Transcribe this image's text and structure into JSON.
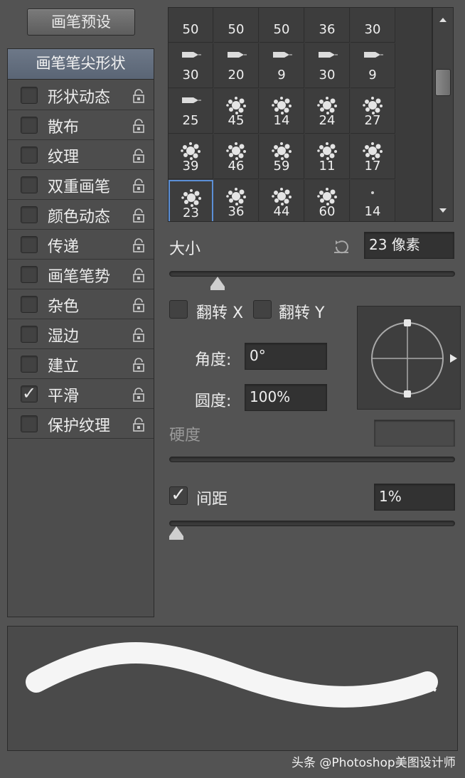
{
  "preset_button": "画笔预设",
  "left_panel": {
    "header": "画笔笔尖形状",
    "options": [
      {
        "label": "形状动态",
        "checked": false
      },
      {
        "label": "散布",
        "checked": false
      },
      {
        "label": "纹理",
        "checked": false
      },
      {
        "label": "双重画笔",
        "checked": false
      },
      {
        "label": "颜色动态",
        "checked": false
      },
      {
        "label": "传递",
        "checked": false
      },
      {
        "label": "画笔笔势",
        "checked": false
      },
      {
        "label": "杂色",
        "checked": false
      },
      {
        "label": "湿边",
        "checked": false
      },
      {
        "label": "建立",
        "checked": false
      },
      {
        "label": "平滑",
        "checked": true
      },
      {
        "label": "保护纹理",
        "checked": false
      }
    ]
  },
  "brush_grid": {
    "rows": [
      [
        {
          "size": "50",
          "kind": "round"
        },
        {
          "size": "50",
          "kind": "round"
        },
        {
          "size": "50",
          "kind": "round"
        },
        {
          "size": "36",
          "kind": "round"
        },
        {
          "size": "30",
          "kind": "round"
        }
      ],
      [
        {
          "size": "30",
          "kind": "pen"
        },
        {
          "size": "20",
          "kind": "pen"
        },
        {
          "size": "9",
          "kind": "pen"
        },
        {
          "size": "30",
          "kind": "pen"
        },
        {
          "size": "9",
          "kind": "pen"
        }
      ],
      [
        {
          "size": "25",
          "kind": "pen"
        },
        {
          "size": "45",
          "kind": "splatter"
        },
        {
          "size": "14",
          "kind": "splatter"
        },
        {
          "size": "24",
          "kind": "splatter"
        },
        {
          "size": "27",
          "kind": "splatter"
        }
      ],
      [
        {
          "size": "39",
          "kind": "splatter"
        },
        {
          "size": "46",
          "kind": "splatter"
        },
        {
          "size": "59",
          "kind": "splatter"
        },
        {
          "size": "11",
          "kind": "splatter"
        },
        {
          "size": "17",
          "kind": "splatter"
        }
      ],
      [
        {
          "size": "23",
          "kind": "splatter",
          "selected": true
        },
        {
          "size": "36",
          "kind": "splatter"
        },
        {
          "size": "44",
          "kind": "splatter"
        },
        {
          "size": "60",
          "kind": "splatter"
        },
        {
          "size": "14",
          "kind": "dot"
        }
      ]
    ]
  },
  "size": {
    "label": "大小",
    "value": "23 像素",
    "slider_fraction": 0.11
  },
  "flip_x": {
    "label": "翻转 X",
    "checked": false
  },
  "flip_y": {
    "label": "翻转 Y",
    "checked": false
  },
  "angle": {
    "label": "角度:",
    "value": "0°"
  },
  "roundness": {
    "label": "圆度:",
    "value": "100%"
  },
  "hardness": {
    "label": "硬度",
    "value": ""
  },
  "spacing": {
    "label": "间距",
    "value": "1%",
    "checked": true,
    "slider_fraction": 0.0
  },
  "icons": {
    "reset": "reset-icon",
    "lock": "lock-icon",
    "angle": "angle-compass-icon"
  },
  "footer": "头条 @Photoshop美图设计师"
}
